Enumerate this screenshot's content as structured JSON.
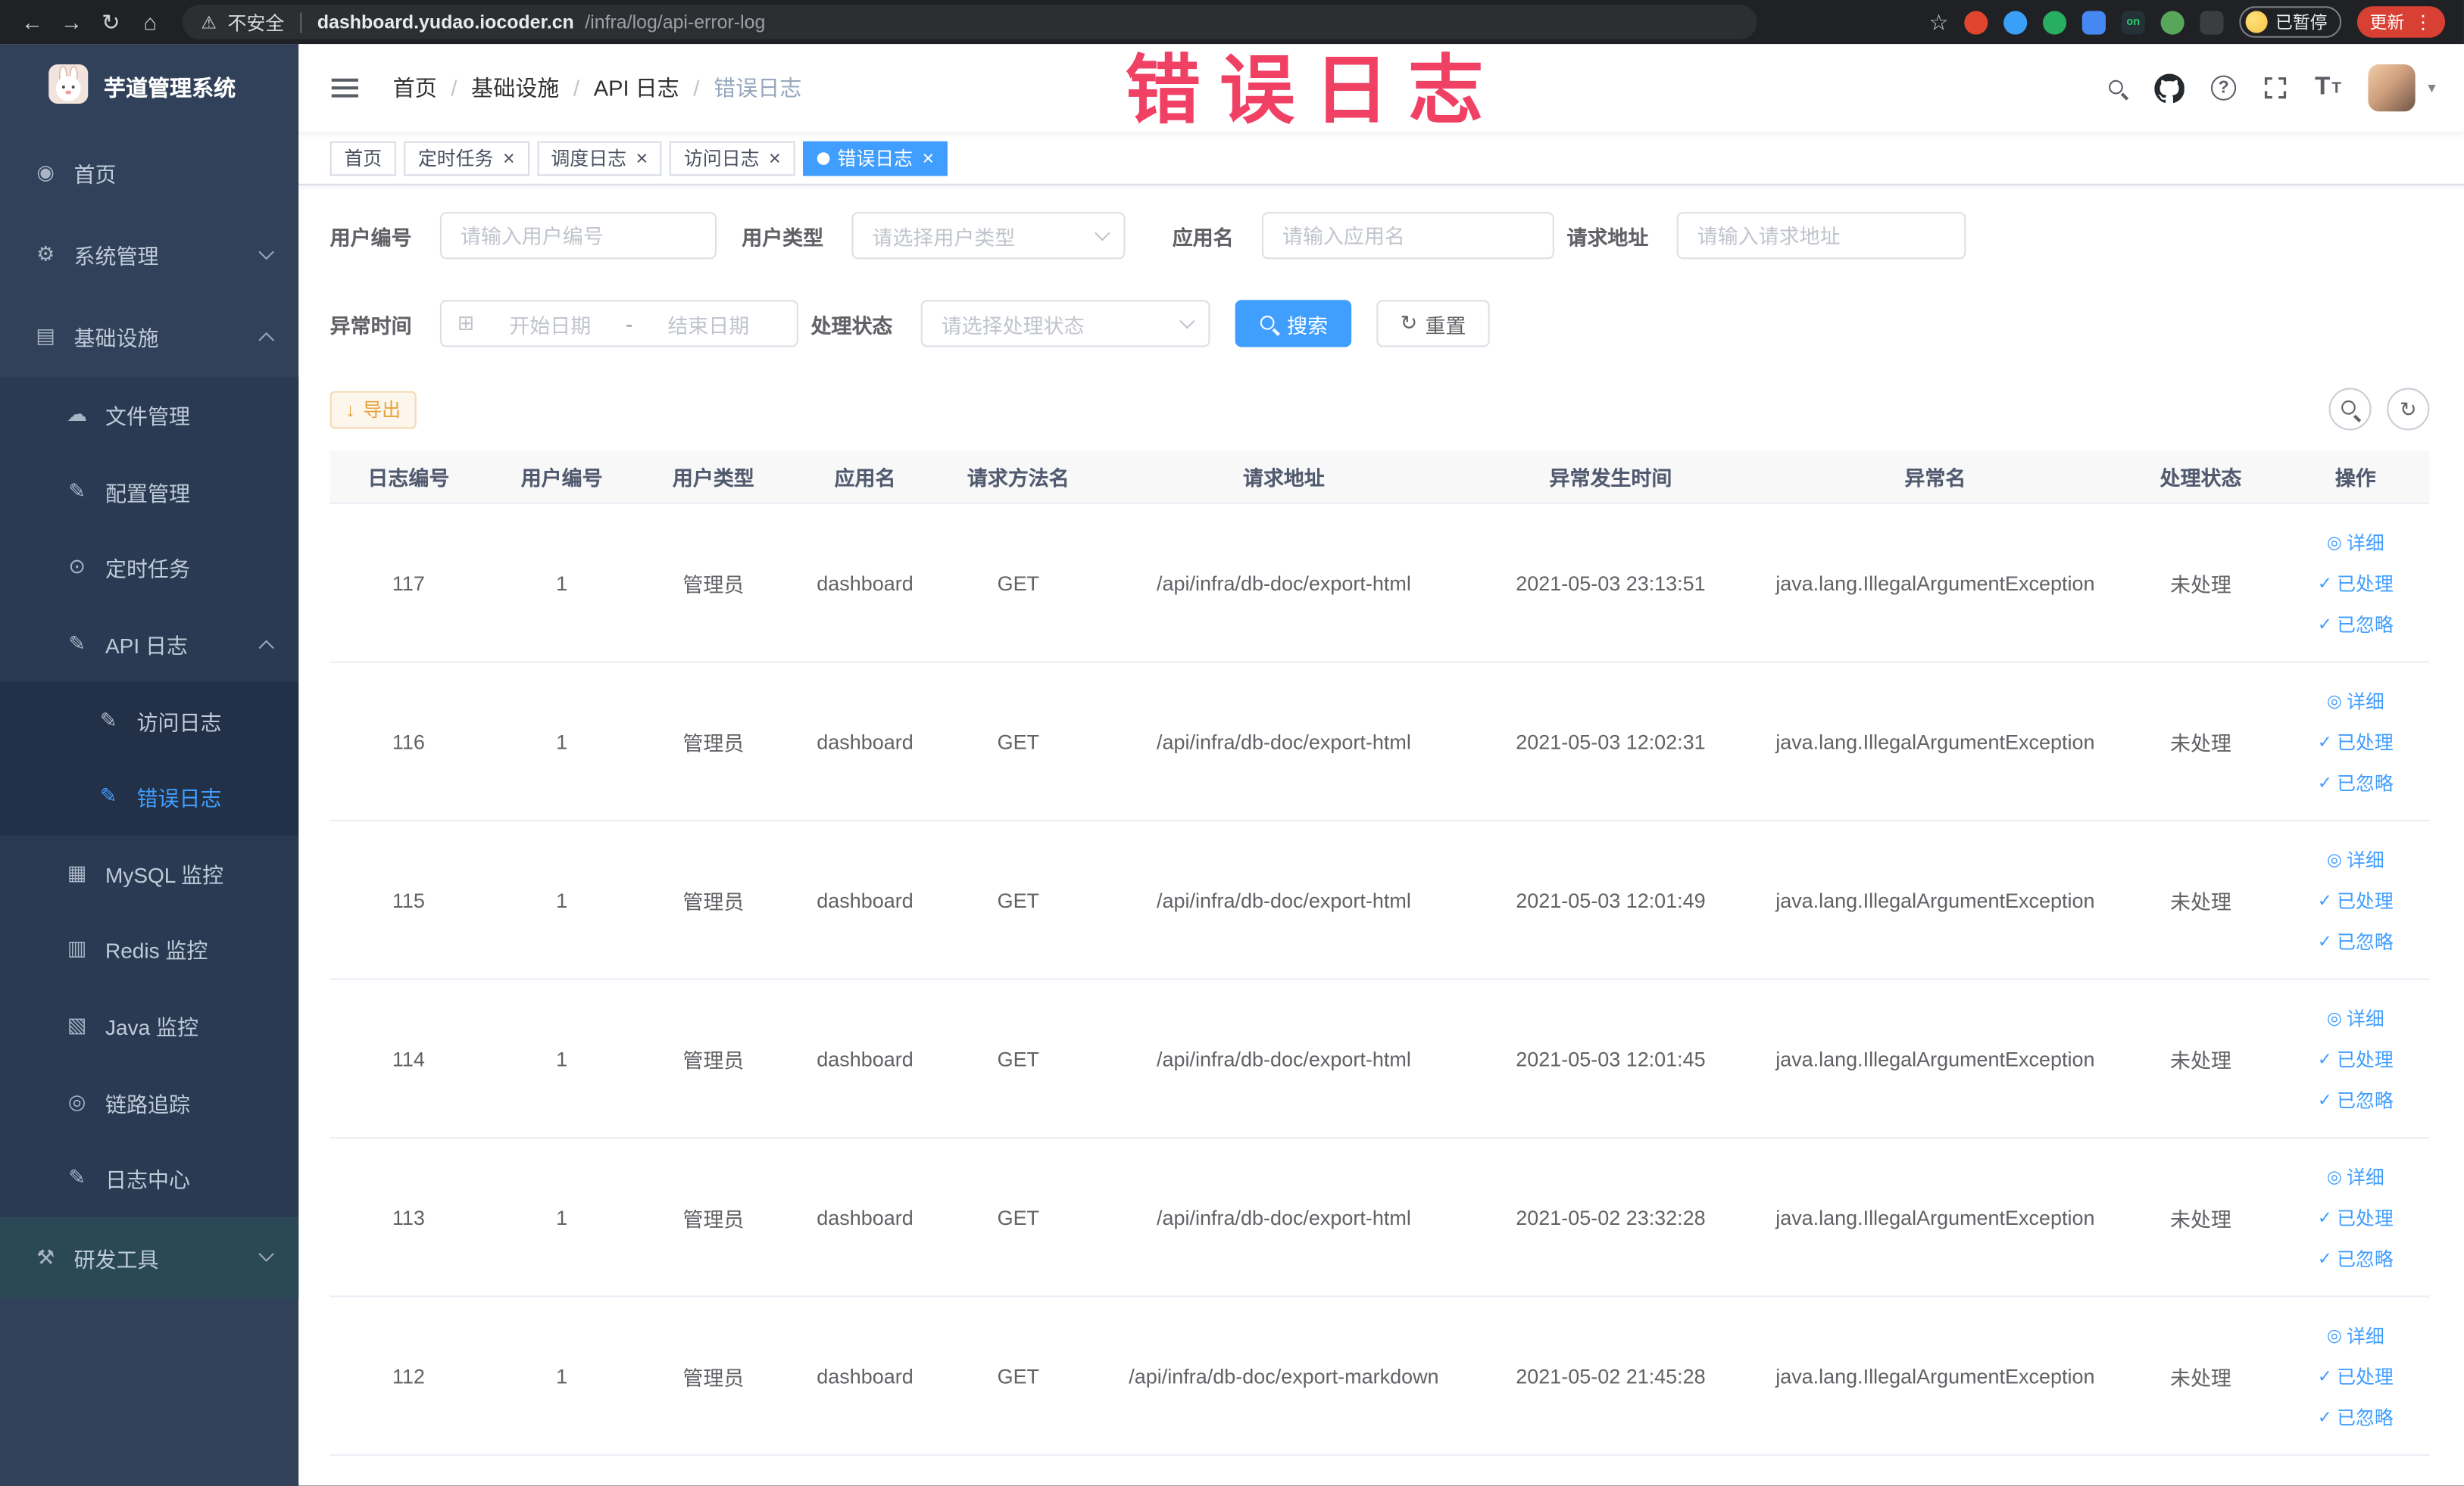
{
  "browser": {
    "security_label": "不安全",
    "url_host": "dashboard.yudao.iocoder.cn",
    "url_path": "/infra/log/api-error-log",
    "profile_badge": "已暂停",
    "update_button": "更新",
    "extension_on_label": "on"
  },
  "watermark": "错误日志",
  "icon_glyphs": {
    "home-icon": "◉",
    "gear-icon": "⚙",
    "infra-icon": "▤",
    "file-icon": "☁",
    "config-icon": "✎",
    "job-icon": "⊙",
    "api-log-icon": "✎",
    "access-log-icon": "✎",
    "error-log-icon": "✎",
    "mysql-icon": "▦",
    "redis-icon": "▥",
    "java-icon": "▧",
    "trace-icon": "◎",
    "log-center-icon": "✎",
    "tool-icon": "⚒",
    "eye-icon": "◎",
    "check-icon": "✓",
    "download-icon": "↓",
    "refresh-icon": "↻",
    "calendar-icon": "⊞"
  },
  "sidebar": {
    "logo_title": "芋道管理系统",
    "menu": [
      {
        "name": "home",
        "label": "首页",
        "icon": "home-icon",
        "level": 1
      },
      {
        "name": "system-mgmt",
        "label": "系统管理",
        "icon": "gear-icon",
        "level": 1,
        "chevron": "down"
      },
      {
        "name": "infrastructure",
        "label": "基础设施",
        "icon": "infra-icon",
        "level": 1,
        "chevron": "up"
      },
      {
        "name": "file-mgmt",
        "label": "文件管理",
        "icon": "file-icon",
        "level": 2
      },
      {
        "name": "config-mgmt",
        "label": "配置管理",
        "icon": "config-icon",
        "level": 2
      },
      {
        "name": "scheduled-jobs",
        "label": "定时任务",
        "icon": "job-icon",
        "level": 2
      },
      {
        "name": "api-log",
        "label": "API 日志",
        "icon": "api-log-icon",
        "level": 2,
        "chevron": "up"
      },
      {
        "name": "access-log",
        "label": "访问日志",
        "icon": "access-log-icon",
        "level": 3
      },
      {
        "name": "error-log",
        "label": "错误日志",
        "icon": "error-log-icon",
        "level": 3,
        "active": true
      },
      {
        "name": "mysql-monitor",
        "label": "MySQL 监控",
        "icon": "mysql-icon",
        "level": 2
      },
      {
        "name": "redis-monitor",
        "label": "Redis 监控",
        "icon": "redis-icon",
        "level": 2
      },
      {
        "name": "java-monitor",
        "label": "Java 监控",
        "icon": "java-icon",
        "level": 2
      },
      {
        "name": "tracer",
        "label": "链路追踪",
        "icon": "trace-icon",
        "level": 2
      },
      {
        "name": "log-center",
        "label": "日志中心",
        "icon": "log-center-icon",
        "level": 2
      },
      {
        "name": "dev-tools",
        "label": "研发工具",
        "icon": "tool-icon",
        "level": 1,
        "chevron": "down",
        "hover": true
      }
    ]
  },
  "topbar": {
    "breadcrumb": [
      {
        "name": "home",
        "label": "首页"
      },
      {
        "name": "infrastructure",
        "label": "基础设施"
      },
      {
        "name": "api-log",
        "label": "API 日志"
      },
      {
        "name": "error-log",
        "label": "错误日志",
        "current": true
      }
    ]
  },
  "tabs": [
    {
      "name": "home",
      "label": "首页",
      "closable": false,
      "active": false
    },
    {
      "name": "job",
      "label": "定时任务",
      "closable": true,
      "active": false
    },
    {
      "name": "job-log",
      "label": "调度日志",
      "closable": true,
      "active": false
    },
    {
      "name": "access-log",
      "label": "访问日志",
      "closable": true,
      "active": false
    },
    {
      "name": "error-log",
      "label": "错误日志",
      "closable": true,
      "active": true
    }
  ],
  "filters": {
    "user_id": {
      "label": "用户编号",
      "placeholder": "请输入用户编号"
    },
    "user_type": {
      "label": "用户类型",
      "placeholder": "请选择用户类型"
    },
    "app_name": {
      "label": "应用名",
      "placeholder": "请输入应用名"
    },
    "request_url": {
      "label": "请求地址",
      "placeholder": "请输入请求地址"
    },
    "exception_time": {
      "label": "异常时间",
      "start_placeholder": "开始日期",
      "separator": "-",
      "end_placeholder": "结束日期"
    },
    "process_status": {
      "label": "处理状态",
      "placeholder": "请选择处理状态"
    },
    "search_button": "搜索",
    "reset_button": "重置"
  },
  "toolbar": {
    "export_label": "导出"
  },
  "table": {
    "columns": [
      "日志编号",
      "用户编号",
      "用户类型",
      "应用名",
      "请求方法名",
      "请求地址",
      "异常发生时间",
      "异常名",
      "处理状态",
      "操作"
    ],
    "action_labels": [
      "详细",
      "已处理",
      "已忽略"
    ],
    "rows": [
      {
        "id": "117",
        "user_id": "1",
        "user_type": "管理员",
        "app": "dashboard",
        "method": "GET",
        "url": "/api/infra/db-doc/export-html",
        "time": "2021-05-03 23:13:51",
        "exception": "java.lang.IllegalArgumentException",
        "status": "未处理"
      },
      {
        "id": "116",
        "user_id": "1",
        "user_type": "管理员",
        "app": "dashboard",
        "method": "GET",
        "url": "/api/infra/db-doc/export-html",
        "time": "2021-05-03 12:02:31",
        "exception": "java.lang.IllegalArgumentException",
        "status": "未处理"
      },
      {
        "id": "115",
        "user_id": "1",
        "user_type": "管理员",
        "app": "dashboard",
        "method": "GET",
        "url": "/api/infra/db-doc/export-html",
        "time": "2021-05-03 12:01:49",
        "exception": "java.lang.IllegalArgumentException",
        "status": "未处理"
      },
      {
        "id": "114",
        "user_id": "1",
        "user_type": "管理员",
        "app": "dashboard",
        "method": "GET",
        "url": "/api/infra/db-doc/export-html",
        "time": "2021-05-03 12:01:45",
        "exception": "java.lang.IllegalArgumentException",
        "status": "未处理"
      },
      {
        "id": "113",
        "user_id": "1",
        "user_type": "管理员",
        "app": "dashboard",
        "method": "GET",
        "url": "/api/infra/db-doc/export-html",
        "time": "2021-05-02 23:32:28",
        "exception": "java.lang.IllegalArgumentException",
        "status": "未处理"
      },
      {
        "id": "112",
        "user_id": "1",
        "user_type": "管理员",
        "app": "dashboard",
        "method": "GET",
        "url": "/api/infra/db-doc/export-markdown",
        "time": "2021-05-02 21:45:28",
        "exception": "java.lang.IllegalArgumentException",
        "status": "未处理"
      }
    ]
  }
}
